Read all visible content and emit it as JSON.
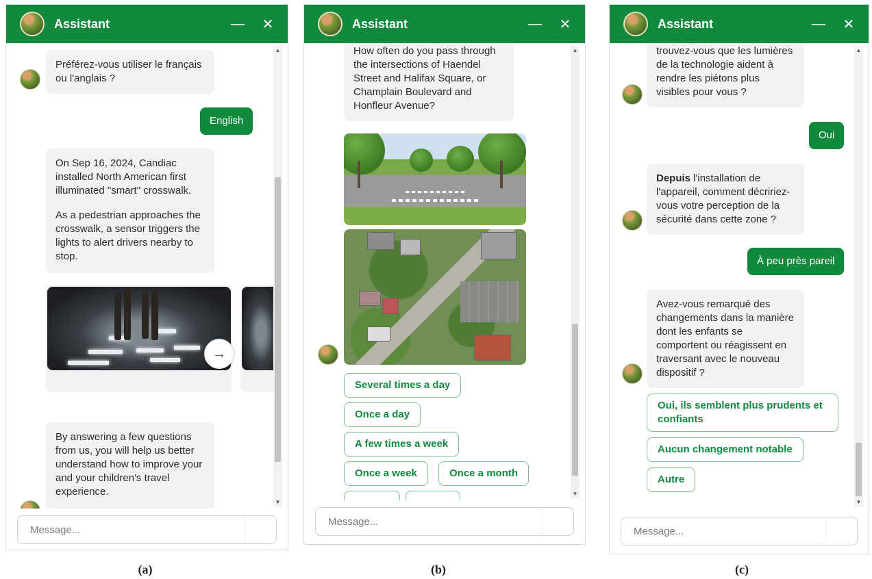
{
  "panels": {
    "a": {
      "header": {
        "title": "Assistant",
        "minimize_icon": "minimize-icon",
        "close_icon": "close-icon"
      },
      "messages": {
        "lang_question": "Préférez-vous utiliser le français ou l'anglais ?",
        "user_reply": "English",
        "info_p1": "On Sep 16, 2024, Candiac installed North American first illuminated \"smart\" crosswalk.",
        "info_p2": "As a pedestrian approaches the crosswalk, a sensor triggers the lights to alert drivers nearby to stop.",
        "survey_intro": "By answering a few questions from us, you will help us better understand how to improve your and your children's travel experience."
      },
      "carousel_next_icon": "arrow-right-icon",
      "input": {
        "placeholder": "Message..."
      },
      "caption": "(a)"
    },
    "b": {
      "header": {
        "title": "Assistant",
        "minimize_icon": "minimize-icon",
        "close_icon": "close-icon"
      },
      "messages": {
        "question": "How often do you pass through the intersections of Haendel Street and Halifax Square, or Champlain Boulevard and Honfleur Avenue?"
      },
      "choices": [
        "Several times a day",
        "Once a day",
        "A few times a week",
        "Once a week",
        "Once a month"
      ],
      "input": {
        "placeholder": "Message..."
      },
      "caption": "(b)"
    },
    "c": {
      "header": {
        "title": "Assistant",
        "minimize_icon": "minimize-icon",
        "close_icon": "close-icon"
      },
      "messages": {
        "q1_partial": "trouvez-vous que les lumières de la technologie aident à rendre les piétons plus visibles pour vous ?",
        "reply1": "Oui",
        "q2_bold": "Depuis",
        "q2_rest": " l'installation de l'appareil, comment décririez-vous votre perception de la sécurité dans cette zone ?",
        "reply2": "À peu près pareil",
        "q3": "Avez-vous remarqué des changements dans la manière dont les enfants se comportent ou réagissent en traversant avec le nouveau dispositif ?"
      },
      "choices": [
        "Oui, ils semblent plus prudents et confiants",
        "Aucun changement notable",
        "Autre"
      ],
      "input": {
        "placeholder": "Message..."
      },
      "caption": "(c)"
    }
  },
  "colors": {
    "brand_green": "#128a3e",
    "bubble_gray": "#f2f2f2"
  }
}
